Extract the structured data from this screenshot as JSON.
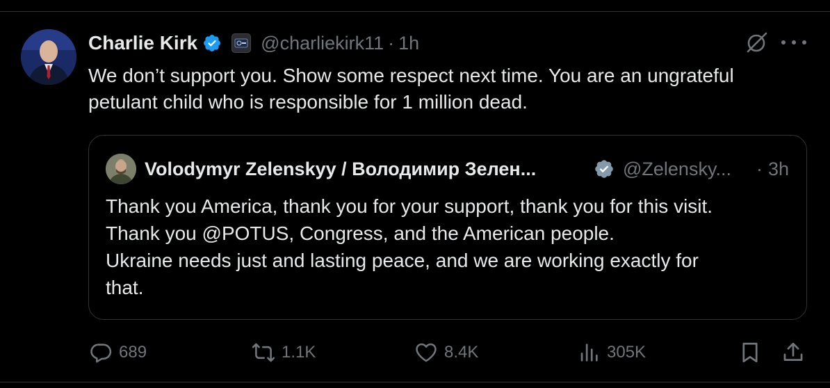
{
  "tweet": {
    "author": {
      "display_name": "Charlie Kirk",
      "handle": "@charliekirk11",
      "verified": true,
      "avatar_icon": "avatar-charlie-kirk"
    },
    "time": "1h",
    "separator": "·",
    "text_lines": [
      "We don’t support you. Show some respect next time. You are an ungrateful",
      "petulant child who is responsible for 1 million dead."
    ],
    "quote": {
      "author": {
        "display_name": "Volodymyr Zelenskyy / Володимир Зелен...",
        "handle": "@Zelensky...",
        "verified": true,
        "verified_color": "#829aab"
      },
      "separator": "·",
      "time": "3h",
      "text_lines": [
        "Thank you America, thank you for your support, thank you for this visit.",
        "Thank you @POTUS, Congress, and the American people.",
        "Ukraine needs just and lasting peace, and we are working exactly for",
        "that."
      ]
    },
    "actions": {
      "replies": "689",
      "reposts": "1.1K",
      "likes": "8.4K",
      "views": "305K"
    }
  },
  "colors": {
    "background": "#000000",
    "text": "#e7e9ea",
    "muted": "#71767b",
    "border": "#2f3336",
    "verified_blue": "#1d9bf0"
  }
}
